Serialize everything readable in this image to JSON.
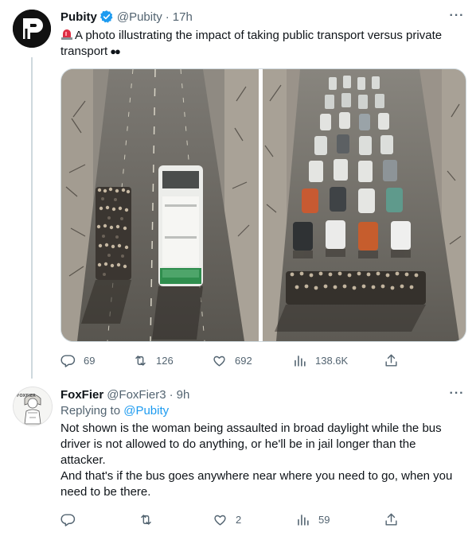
{
  "tweet1": {
    "name": "Pubity",
    "handle": "@Pubity",
    "dot": "·",
    "time": "17h",
    "text": "A photo illustrating the impact of taking public transport versus private transport",
    "replies": "69",
    "retweets": "126",
    "likes": "692",
    "views": "138.6K"
  },
  "tweet2": {
    "name": "FoxFier",
    "handle": "@FoxFier3",
    "dot": "·",
    "time": "9h",
    "replying_label": "Replying to",
    "replying_mention": "@Pubity",
    "text1": "Not shown is the woman being assaulted in broad daylight while the bus driver is not allowed to do anything, or he'll be in jail longer than the attacker.",
    "text2": "And that's if the bus goes anywhere near where you need to go, when you need to be there.",
    "replies": "",
    "retweets": "",
    "likes": "2",
    "views": "59"
  },
  "colors": {
    "accent": "#1d9bf0",
    "secondary_text": "#536471"
  }
}
